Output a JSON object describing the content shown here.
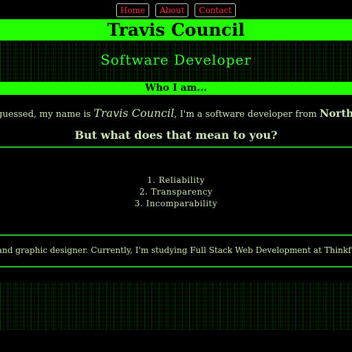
{
  "nav": {
    "home": "Home",
    "about": "About",
    "contact": "Contact"
  },
  "header": {
    "title": "Travis Council",
    "subtitle": "Software Developer"
  },
  "about": {
    "heading": "Who I am...",
    "intro_prefix": "have guessed, my name is ",
    "intro_name": "Travis Council",
    "intro_middle": ", I'm a software developer from ",
    "intro_place": "Northern",
    "question": "But what does that mean to you?",
    "values": [
      "1. Reliability",
      "2. Transparency",
      "3. Incomparability"
    ],
    "outro": "and graphic designer. Currently, I'm studying Full Stack Web Development at Thinkful!"
  },
  "colors": {
    "accent": "#22ff00",
    "nav_text": "#ff2a4a",
    "body_text": "#cfe8b8",
    "background": "#000000"
  }
}
